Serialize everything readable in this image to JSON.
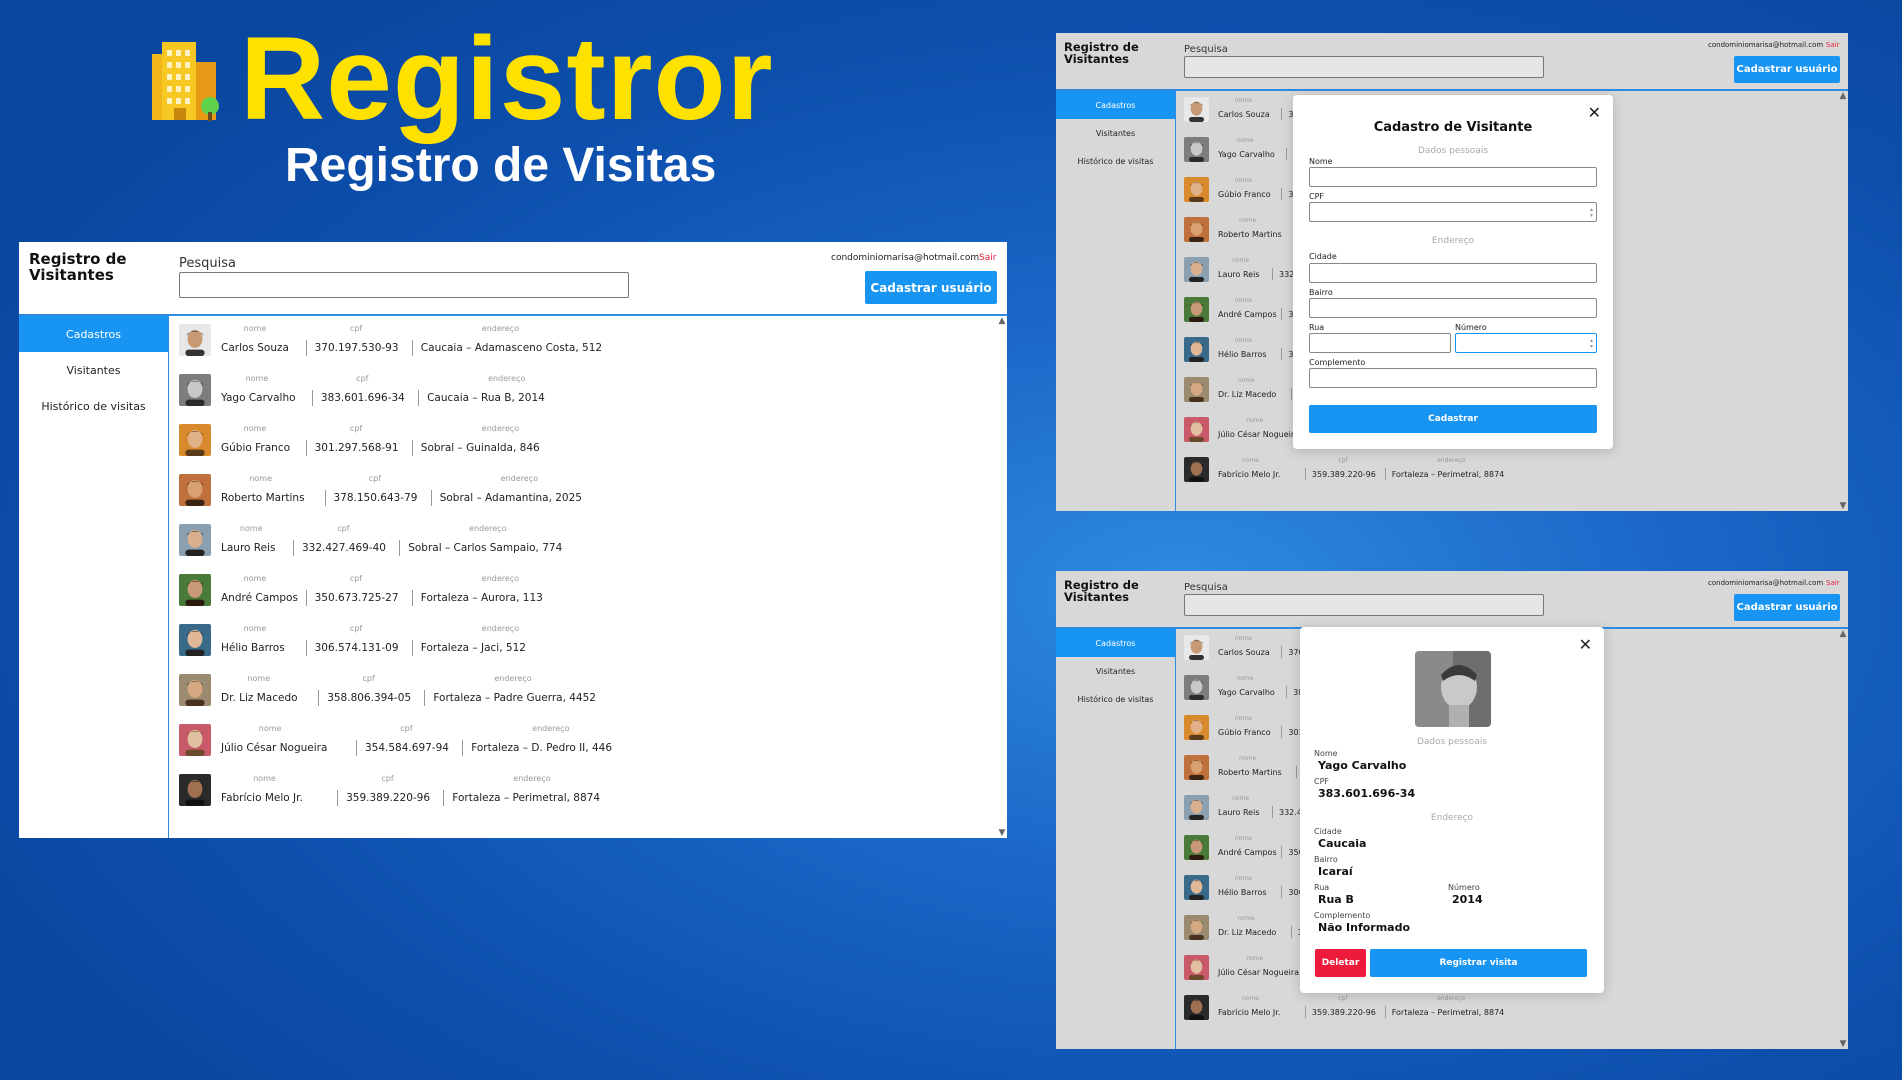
{
  "hero": {
    "title": "Registror",
    "subtitle": "Registro de Visitas",
    "logo_icon": "building-icon"
  },
  "colors": {
    "accent": "#1895f3",
    "danger": "#ee1a3c",
    "hero_yellow": "#ffe100",
    "bg_blue": "#0d4fad"
  },
  "app": {
    "brand_line1": "Registro de",
    "brand_line2": "Visitantes",
    "search_label": "Pesquisa",
    "search_value": "",
    "email": "condominiomarisa@hotmail.com",
    "logout": "Sair",
    "add_user_button": "Cadastrar usuário",
    "nav": [
      {
        "label": "Cadastros",
        "active": true
      },
      {
        "label": "Visitantes",
        "active": false
      },
      {
        "label": "Histórico de visitas",
        "active": false
      }
    ],
    "col_labels": {
      "name": "nome",
      "cpf": "cpf",
      "address": "endereço"
    },
    "visitors": [
      {
        "name": "Carlos Souza",
        "cpf": "370.197.530-93",
        "address": "Caucaia – Adamasceno Costa, 512"
      },
      {
        "name": "Yago Carvalho",
        "cpf": "383.601.696-34",
        "address": "Caucaia – Rua B, 2014"
      },
      {
        "name": "Gúbio Franco",
        "cpf": "301.297.568-91",
        "address": "Sobral – Guinalda, 846"
      },
      {
        "name": "Roberto Martins",
        "cpf": "378.150.643-79",
        "address": "Sobral – Adamantina, 2025"
      },
      {
        "name": "Lauro Reis",
        "cpf": "332.427.469-40",
        "address": "Sobral – Carlos Sampaio, 774"
      },
      {
        "name": "André Campos",
        "cpf": "350.673.725-27",
        "address": "Fortaleza – Aurora, 113"
      },
      {
        "name": "Hélio Barros",
        "cpf": "306.574.131-09",
        "address": "Fortaleza – Jaci, 512"
      },
      {
        "name": "Dr. Liz Macedo",
        "cpf": "358.806.394-05",
        "address": "Fortaleza – Padre Guerra, 4452"
      },
      {
        "name": "Júlio César Nogueira",
        "cpf": "354.584.697-94",
        "address": "Fortaleza – D. Pedro II, 446"
      },
      {
        "name": "Fabrício Melo Jr.",
        "cpf": "359.389.220-96",
        "address": "Fortaleza – Perimetral, 8874"
      }
    ]
  },
  "register_modal": {
    "title": "Cadastro de Visitante",
    "section_personal": "Dados pessoais",
    "section_address": "Endereço",
    "name_label": "Nome",
    "cpf_label": "CPF",
    "city_label": "Cidade",
    "district_label": "Bairro",
    "street_label": "Rua",
    "number_label": "Número",
    "complement_label": "Complemento",
    "submit": "Cadastrar",
    "close_icon": "close-icon"
  },
  "detail_modal": {
    "section_personal": "Dados pessoais",
    "section_address": "Endereço",
    "name_label": "Nome",
    "name_value": "Yago Carvalho",
    "cpf_label": "CPF",
    "cpf_value": "383.601.696-34",
    "city_label": "Cidade",
    "city_value": "Caucaia",
    "district_label": "Bairro",
    "district_value": "Icaraí",
    "street_label": "Rua",
    "street_value": "Rua B",
    "number_label": "Número",
    "number_value": "2014",
    "complement_label": "Complemento",
    "complement_value": "Não Informado",
    "delete_button": "Deletar",
    "visit_button": "Registrar visita",
    "close_icon": "close-icon"
  }
}
